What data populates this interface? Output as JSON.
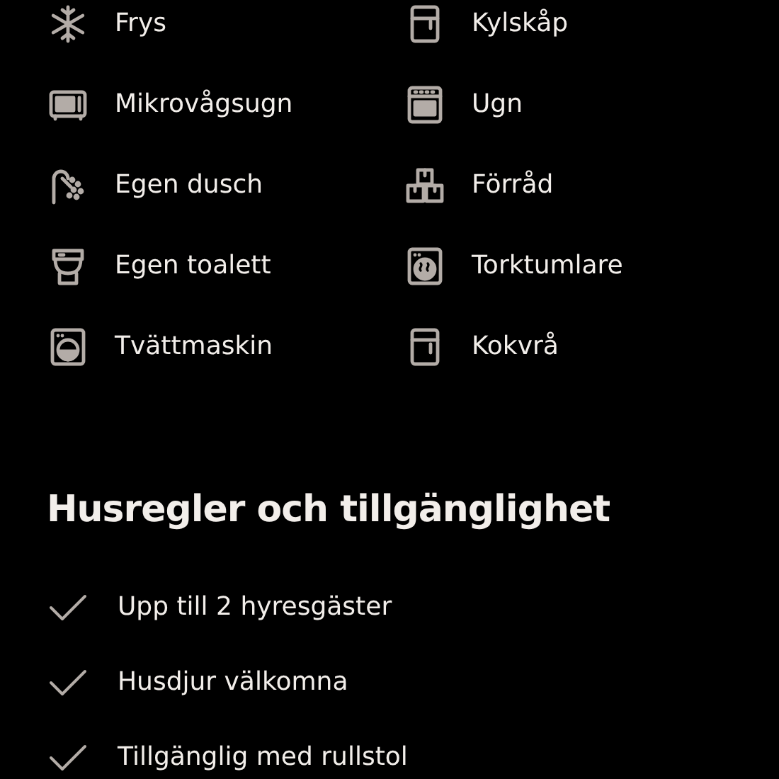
{
  "amenities": [
    {
      "label": "Frys",
      "kind": "snowflake"
    },
    {
      "label": "Kylskåp",
      "kind": "fridge"
    },
    {
      "label": "Mikrovågsugn",
      "kind": "microwave"
    },
    {
      "label": "Ugn",
      "kind": "oven"
    },
    {
      "label": "Egen dusch",
      "kind": "shower"
    },
    {
      "label": "Förråd",
      "kind": "boxes"
    },
    {
      "label": "Egen toalett",
      "kind": "toilet"
    },
    {
      "label": "Torktumlare",
      "kind": "dryer"
    },
    {
      "label": "Tvättmaskin",
      "kind": "washer"
    },
    {
      "label": "Kokvrå",
      "kind": "kitchenette"
    }
  ],
  "rules": {
    "title": "Husregler och tillgänglighet",
    "items": [
      {
        "label": "Upp till 2 hyresgäster"
      },
      {
        "label": "Husdjur välkomna"
      },
      {
        "label": "Tillgänglig med rullstol"
      }
    ]
  }
}
